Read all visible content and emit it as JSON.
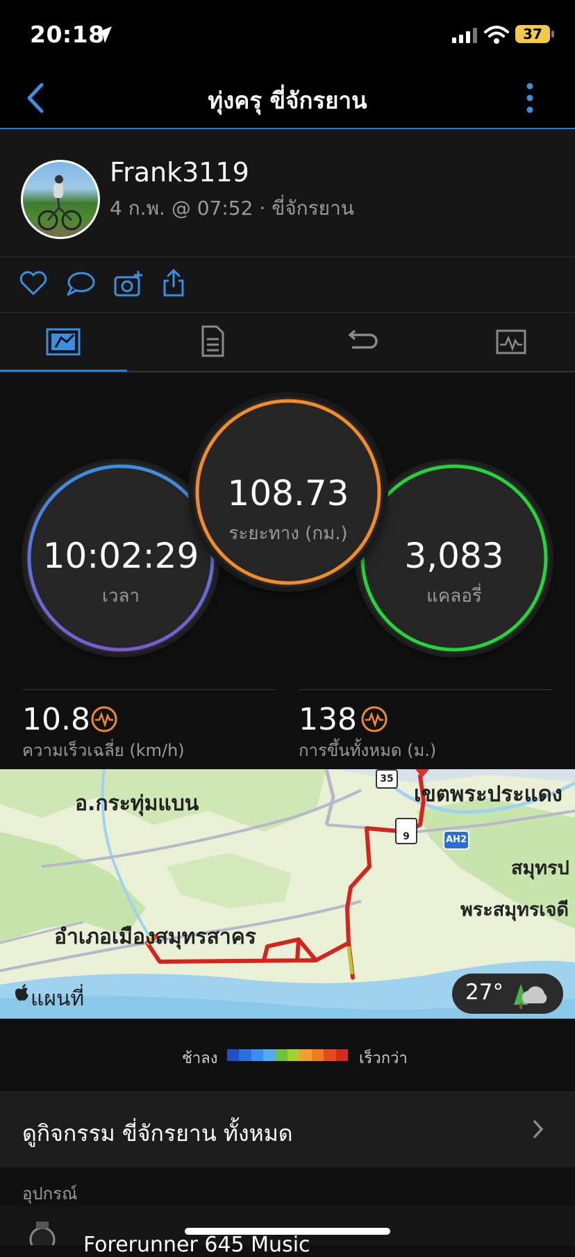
{
  "status_bar": {
    "time": "20:18",
    "battery": "37"
  },
  "header": {
    "title": "ทุ่งครุ ขี่จักรยาน"
  },
  "profile": {
    "username": "Frank3119",
    "subtitle": "4 ก.พ. @ 07:52 · ขี่จักรยาน"
  },
  "stats": {
    "distance": {
      "value": "108.73",
      "label": "ระยะทาง (กม.)"
    },
    "time": {
      "value": "10:02:29",
      "label": "เวลา"
    },
    "calories": {
      "value": "3,083",
      "label": "แคลอรี่"
    },
    "avg_speed": {
      "value": "10.8",
      "label": "ความเร็วเฉลี่ย (km/h)"
    },
    "total_ascent": {
      "value": "138",
      "label": "การขึ้นทั้งหมด (ม.)"
    }
  },
  "map": {
    "labels": {
      "kra_thum_baen": "อ.กระทุ่มแบน",
      "khet_phra_pradaeng": "เขตพระประแดง",
      "samut_prakan_short": "สมุทรป",
      "phra_samut_chedi": "พระสมุทรเจดี",
      "mueang_samut_sakhon": "อำเภอเมืองสมุทรสาคร"
    },
    "shields": {
      "route_35": "35",
      "route_9": "9",
      "ah2": "AH2"
    },
    "brand": "แผนที่",
    "weather": {
      "temp": "27°",
      "icon": "cloud-tree-icon"
    }
  },
  "legend": {
    "slow_label": "ช้าลง",
    "fast_label": "เร็วกว่า",
    "colors": [
      "#1f4fc4",
      "#2a6ee0",
      "#3a8ef0",
      "#55aaf5",
      "#6fc23a",
      "#a8cf32",
      "#f0a030",
      "#f07a20",
      "#e64a1e",
      "#d62a20"
    ]
  },
  "links": {
    "all_activities": "ดูกิจกรรม ขี่จักรยาน ทั้งหมด"
  },
  "equipment": {
    "section_label": "อุปกรณ์",
    "device_name": "Forerunner 645 Music"
  },
  "colors": {
    "accent": "#2b7fd0",
    "time_ring": "#4a90e2",
    "distance_ring": "#f28c28",
    "calories_ring": "#22d63a",
    "route": "#d4251c"
  }
}
